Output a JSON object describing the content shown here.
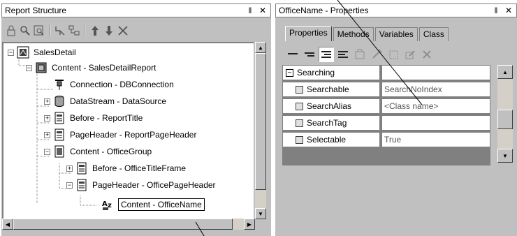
{
  "left_panel": {
    "title": "Report Structure",
    "pin_glyph": "‖",
    "close_glyph": "✕"
  },
  "tree": {
    "items": [
      {
        "label": "SalesDetail",
        "expander": "−",
        "icon": "report-icon"
      },
      {
        "label": "Content - SalesDetailReport",
        "expander": "−",
        "icon": "content-icon"
      },
      {
        "label": "Connection - DBConnection",
        "expander": "",
        "icon": "connection-icon"
      },
      {
        "label": "DataStream - DataSource",
        "expander": "+",
        "icon": "datastream-icon"
      },
      {
        "label": "Before - ReportTitle",
        "expander": "+",
        "icon": "frame-icon"
      },
      {
        "label": "PageHeader - ReportPageHeader",
        "expander": "+",
        "icon": "frame-icon"
      },
      {
        "label": "Content - OfficeGroup",
        "expander": "−",
        "icon": "group-icon"
      },
      {
        "label": "Before - OfficeTitleFrame",
        "expander": "+",
        "icon": "frame-icon"
      },
      {
        "label": "PageHeader - OfficePageHeader",
        "expander": "−",
        "icon": "frame-icon"
      },
      {
        "label": "Content - OfficeName",
        "expander": "",
        "icon": "field-icon"
      }
    ]
  },
  "right_panel": {
    "title": "OfficeName - Properties",
    "pin_glyph": "‖",
    "close_glyph": "✕"
  },
  "tabs": [
    {
      "label": "Properties",
      "active": true
    },
    {
      "label": "Methods",
      "active": false
    },
    {
      "label": "Variables",
      "active": false
    },
    {
      "label": "Class",
      "active": false
    }
  ],
  "properties": {
    "group": {
      "name": "Searching",
      "value": ""
    },
    "rows": [
      {
        "name": "Searchable",
        "value": "SearchNoIndex"
      },
      {
        "name": "SearchAlias",
        "value": "<Class name>"
      },
      {
        "name": "SearchTag",
        "value": ""
      },
      {
        "name": "Selectable",
        "value": "True"
      }
    ]
  }
}
